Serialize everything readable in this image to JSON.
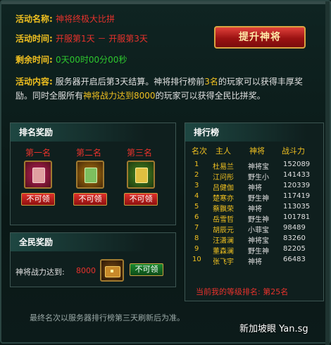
{
  "event": {
    "name_label": "活动名称:",
    "name_value": "神将终极大比拼",
    "time_label": "活动时间:",
    "time_value": "开服第1天 － 开服第3天",
    "remaining_label": "剩余时间:",
    "remaining_value": "0天00时00分00秒",
    "content_label": "活动内容:",
    "content_part1": "服务器开启后第3天结算。神将排行榜前",
    "content_top": "3名",
    "content_part2": "的玩家可以获得丰厚奖励。同时全服所有",
    "content_part3": "神将战力达到",
    "content_threshold": "8000",
    "content_part4": "的玩家可以获得全民比拼奖。"
  },
  "upgrade_button": "提升神将",
  "rank_rewards": {
    "title": "排名奖励",
    "places": [
      {
        "label": "第一名",
        "button": "不可领"
      },
      {
        "label": "第二名",
        "button": "不可领"
      },
      {
        "label": "第三名",
        "button": "不可领"
      }
    ]
  },
  "all_rewards": {
    "title": "全民奖励",
    "label": "神将战力达到:",
    "value": "8000",
    "button": "不可领"
  },
  "leaderboard": {
    "title": "排行榜",
    "headers": [
      "名次",
      "主人",
      "神将",
      "战斗力"
    ],
    "rows": [
      {
        "rank": "1",
        "owner": "杜易兰",
        "general": "神将宝",
        "power": "152089"
      },
      {
        "rank": "2",
        "owner": "江问彤",
        "general": "野生小",
        "power": "141433"
      },
      {
        "rank": "3",
        "owner": "吕健伽",
        "general": "神将",
        "power": "120339"
      },
      {
        "rank": "4",
        "owner": "楚寒亦",
        "general": "野生神",
        "power": "117419"
      },
      {
        "rank": "5",
        "owner": "蔡飘荣",
        "general": "神将",
        "power": "113035"
      },
      {
        "rank": "6",
        "owner": "岳雪哲",
        "general": "野生神",
        "power": "101781"
      },
      {
        "rank": "7",
        "owner": "胡辰元",
        "general": "小菲宝",
        "power": "98489"
      },
      {
        "rank": "8",
        "owner": "汪潇澜",
        "general": "神将宝",
        "power": "83260"
      },
      {
        "rank": "9",
        "owner": "董森澜",
        "general": "野生神",
        "power": "82205"
      },
      {
        "rank": "10",
        "owner": "张飞宇",
        "general": "神将",
        "power": "66483"
      }
    ],
    "my_rank": "当前我的等级排名: 第25名"
  },
  "footer_note": "最终名次以服务器排行榜第三天刷新后为准。",
  "watermark": "新加坡眼 Yan.sg"
}
